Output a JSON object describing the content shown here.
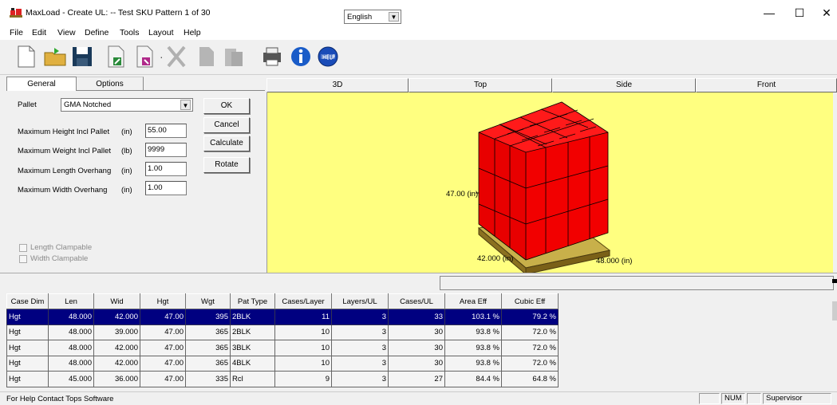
{
  "window": {
    "title": "MaxLoad - Create UL:  -- Test SKU  Pattern 1 of 30",
    "minimize": "—",
    "maximize": "☐",
    "close": "✕"
  },
  "menu": [
    "File",
    "Edit",
    "View",
    "Define",
    "Tools",
    "Layout",
    "Help"
  ],
  "toolbar": {
    "icons": [
      "new-document-icon",
      "open-folder-icon",
      "save-disk-icon",
      "import-icon",
      "export-icon",
      "cut-icon",
      "copy-icon",
      "paste-icon",
      "print-icon",
      "info-icon",
      "help-icon"
    ],
    "language_value": "English"
  },
  "tabs": {
    "general": "General",
    "options": "Options"
  },
  "form": {
    "pallet_label": "Pallet",
    "pallet_value": "GMA Notched",
    "max_height_label": "Maximum Height Incl Pallet",
    "max_height_unit": "(in)",
    "max_height_value": "55.00",
    "max_weight_label": "Maximum Weight Incl Pallet",
    "max_weight_unit": "(lb)",
    "max_weight_value": "9999",
    "max_length_label": "Maximum Length Overhang",
    "max_length_unit": "(in)",
    "max_length_value": "1.00",
    "max_width_label": "Maximum Width Overhang",
    "max_width_unit": "(in)",
    "max_width_value": "1.00",
    "length_clampable": "Length Clampable",
    "width_clampable": "Width Clampable"
  },
  "buttons": {
    "ok": "OK",
    "cancel": "Cancel",
    "calculate": "Calculate",
    "rotate": "Rotate"
  },
  "views": [
    "3D",
    "Top",
    "Side",
    "Front"
  ],
  "load_view": {
    "height_label": "47.00 (in)",
    "length_label": "42.000 (in)",
    "width_label": "48.000 (in)",
    "box_color": "#ff0000",
    "background_color": "#ffff80",
    "pallet_color": "#b59a2a"
  },
  "table": {
    "headers": [
      "Case Dim",
      "Len",
      "Wid",
      "Hgt",
      "Wgt",
      "Pat Type",
      "Cases/Layer",
      "Layers/UL",
      "Cases/UL",
      "Area Eff",
      "Cubic Eff"
    ],
    "rows": [
      [
        "Hgt",
        "48.000",
        "42.000",
        "47.00",
        "395",
        "2BLK",
        "11",
        "3",
        "33",
        "103.1 %",
        "79.2 %"
      ],
      [
        "Hgt",
        "48.000",
        "39.000",
        "47.00",
        "365",
        "2BLK",
        "10",
        "3",
        "30",
        "93.8 %",
        "72.0 %"
      ],
      [
        "Hgt",
        "48.000",
        "42.000",
        "47.00",
        "365",
        "3BLK",
        "10",
        "3",
        "30",
        "93.8 %",
        "72.0 %"
      ],
      [
        "Hgt",
        "48.000",
        "42.000",
        "47.00",
        "365",
        "4BLK",
        "10",
        "3",
        "30",
        "93.8 %",
        "72.0 %"
      ],
      [
        "Hgt",
        "45.000",
        "36.000",
        "47.00",
        "335",
        "Rcl",
        "9",
        "3",
        "27",
        "84.4 %",
        "64.8 %"
      ]
    ],
    "selected_row": 0
  },
  "status": {
    "help_text": "For Help Contact Tops Software",
    "num": "NUM",
    "user": "Supervisor"
  }
}
